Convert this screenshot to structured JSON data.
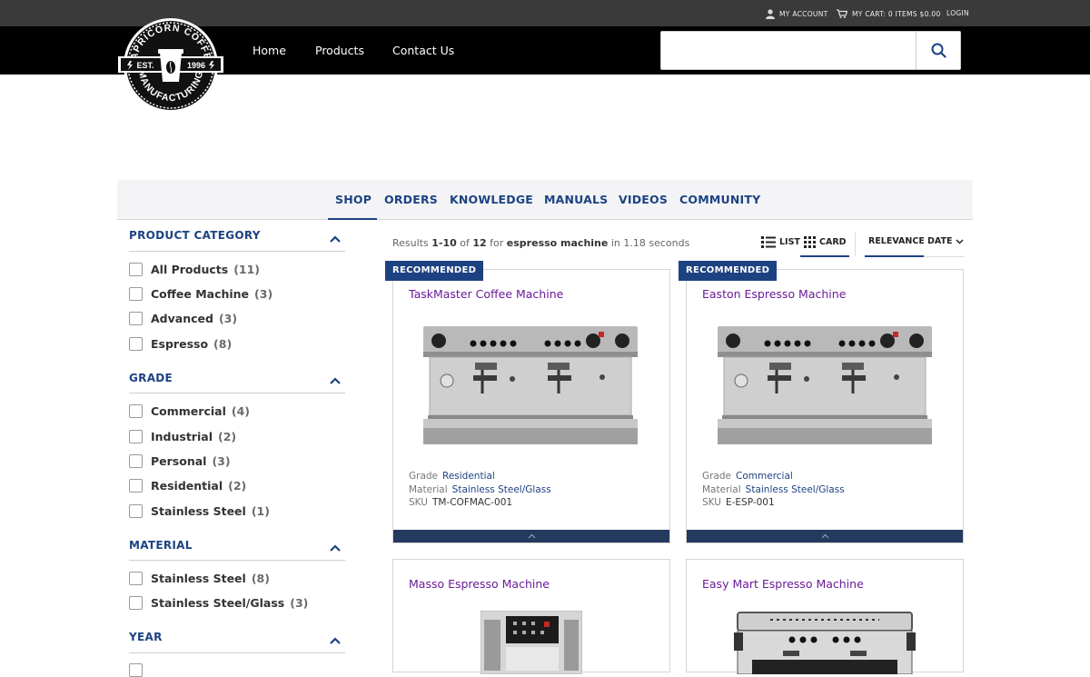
{
  "topbar": {
    "account": "MY ACCOUNT",
    "cart": "MY CART: 0 ITEMS  $0.00",
    "login": "LOGIN"
  },
  "logo": {
    "top_text": "CAPRICORN COFFEE",
    "bottom_text": "MANUFACTURING",
    "est": "EST.",
    "year": "1996"
  },
  "nav": [
    "Home",
    "Products",
    "Contact Us"
  ],
  "search": {
    "value": "",
    "placeholder": ""
  },
  "tabs": [
    "SHOP",
    "ORDERS",
    "KNOWLEDGE",
    "MANUALS",
    "VIDEOS",
    "COMMUNITY"
  ],
  "facets": {
    "product_category": {
      "title": "PRODUCT CATEGORY",
      "items": [
        {
          "label": "All Products",
          "count": "(11)"
        },
        {
          "label": "Coffee Machine",
          "count": "(3)"
        },
        {
          "label": "Advanced",
          "count": "(3)"
        },
        {
          "label": "Espresso",
          "count": "(8)"
        }
      ]
    },
    "grade": {
      "title": "GRADE",
      "items": [
        {
          "label": "Commercial",
          "count": "(4)"
        },
        {
          "label": "Industrial",
          "count": "(2)"
        },
        {
          "label": "Personal",
          "count": "(3)"
        },
        {
          "label": "Residential",
          "count": "(2)"
        },
        {
          "label": "Stainless Steel",
          "count": "(1)"
        }
      ]
    },
    "material": {
      "title": "MATERIAL",
      "items": [
        {
          "label": "Stainless Steel",
          "count": "(8)"
        },
        {
          "label": "Stainless Steel/Glass",
          "count": "(3)"
        }
      ]
    },
    "year": {
      "title": "YEAR"
    }
  },
  "results": {
    "prefix": "Results ",
    "range": "1-10",
    "of": " of ",
    "total": "12",
    "for": " for ",
    "query": "espresso machine",
    "suffix": " in 1.18 seconds"
  },
  "view": {
    "list": "LIST",
    "card": "CARD",
    "relevance": "RELEVANCE",
    "date": "DATE"
  },
  "cards": [
    {
      "badge": "RECOMMENDED",
      "title": "TaskMaster Coffee Machine",
      "grade_label": "Grade",
      "grade": "Residential",
      "material_label": "Material",
      "material": "Stainless Steel/Glass",
      "sku_label": "SKU",
      "sku": "TM-COFMAC-001"
    },
    {
      "badge": "RECOMMENDED",
      "title": "Easton Espresso Machine",
      "grade_label": "Grade",
      "grade": "Commercial",
      "material_label": "Material",
      "material": "Stainless Steel/Glass",
      "sku_label": "SKU",
      "sku": "E-ESP-001"
    },
    {
      "title": "Masso Espresso Machine"
    },
    {
      "title": "Easy Mart Espresso Machine"
    }
  ],
  "colors": {
    "brand_blue": "#1d4282",
    "title_purple": "#6a1b9a",
    "header_black": "#000000",
    "topbar_gray": "#3a3a3a"
  }
}
